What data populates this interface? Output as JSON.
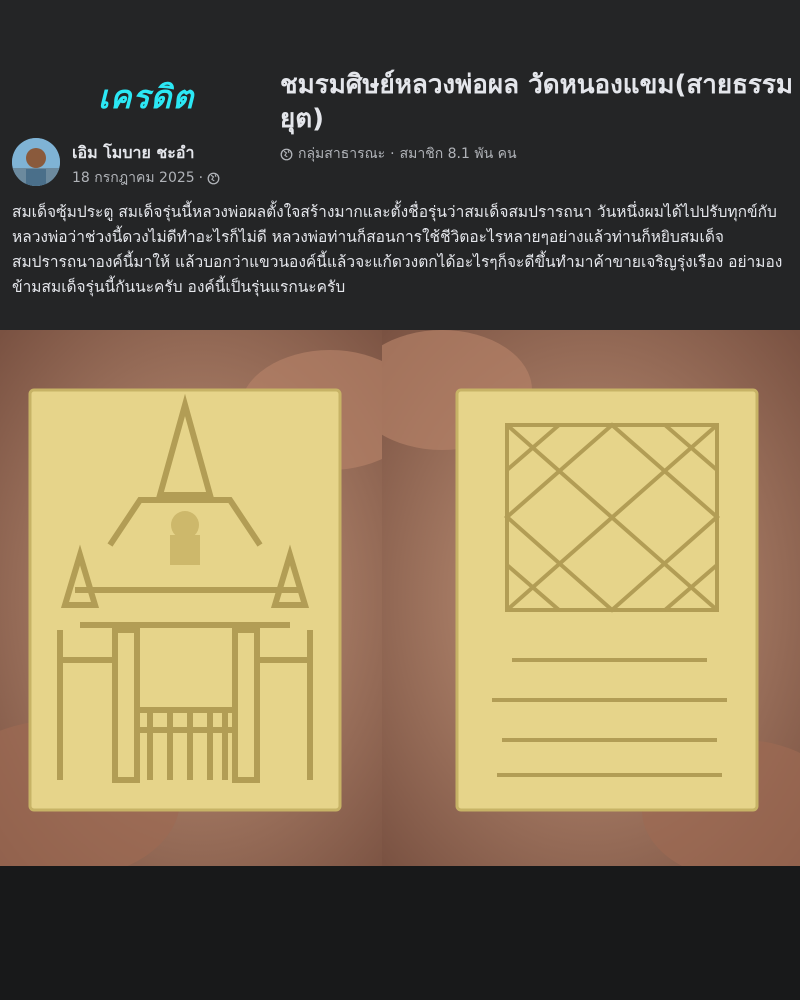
{
  "header": {
    "credit_label": "เครดิต",
    "group_name": "ชมรมศิษย์หลวงพ่อผล วัดหนองแขม(สายธรรมยุต)",
    "group_privacy": "กลุ่มสาธารณะ",
    "group_members": "สมาชิก 8.1 พัน คน"
  },
  "author": {
    "name": "เอิม โมบาย ชะอำ",
    "date": "18 กรกฎาคม 2025"
  },
  "post": {
    "text": "สมเด็จซุ้มประตู สมเด็จรุ่นนี้หลวงพ่อผลตั้งใจสร้างมากและตั้งชื่อรุ่นว่าสมเด็จสมปรารถนา วันหนึ่งผมได้ไปปรับทุกข์กับหลวงพ่อว่าช่วงนี้ดวงไม่ดีทำอะไรก็ไม่ดี หลวงพ่อท่านก็สอนการใช้ชีวิตอะไรหลายๆอย่างแล้วท่านก็หยิบสมเด็จสมปรารถนาองค์นี้มาให้ แล้วบอกว่าแขวนองค์นี้แล้วจะแก้ดวงตกได้อะไรๆก็จะดีขึ้นทำมาค้าขายเจริญรุ่งเรือง อย่ามองข้ามสมเด็จรุ่นนี้กันนะครับ องค์นี้เป็นรุ่นแรกนะครับ"
  },
  "icons": {
    "globe": "globe-icon",
    "privacy": "globe-icon"
  },
  "colors": {
    "credit": "#2be8f5",
    "background": "#242526",
    "text": "#e4e6eb",
    "muted": "#b0b3b8",
    "amulet": "#e6d48a"
  }
}
